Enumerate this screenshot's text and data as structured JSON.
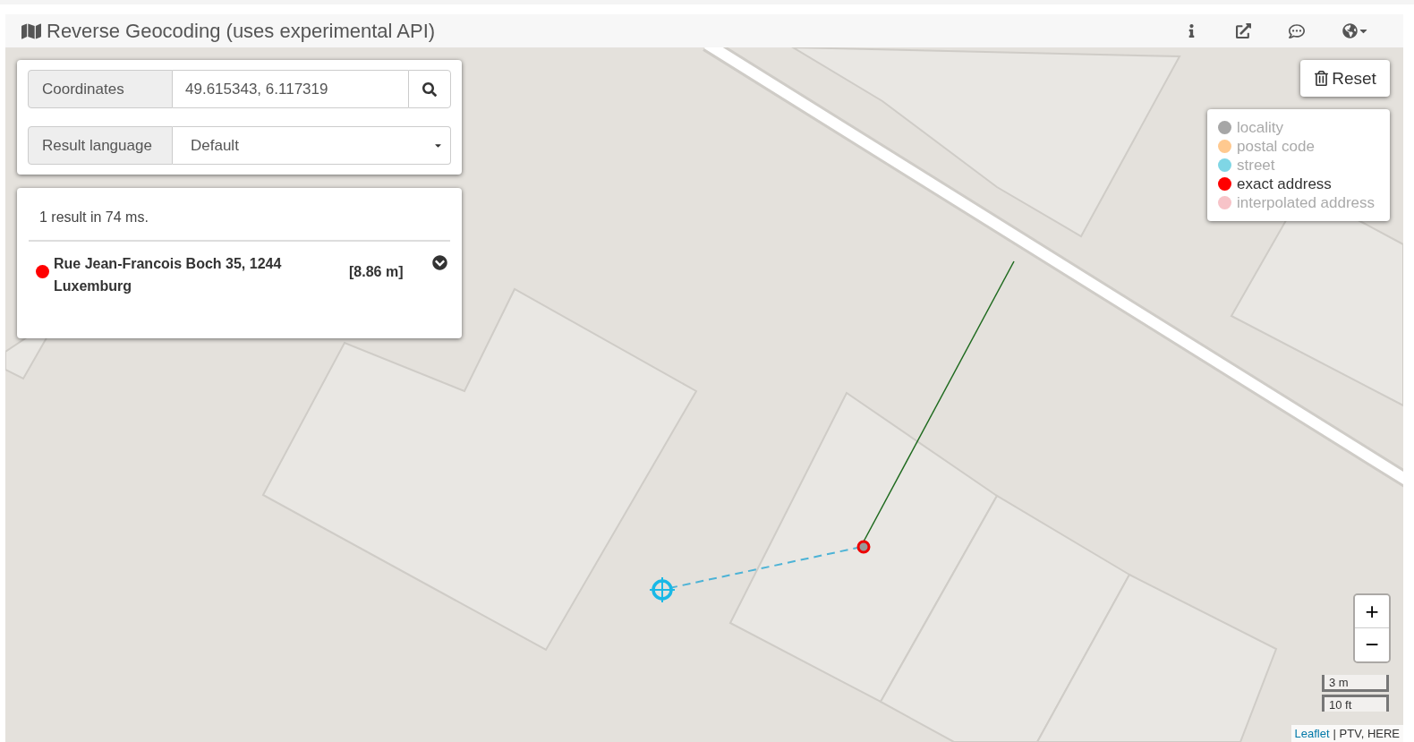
{
  "header": {
    "title": "Reverse Geocoding (uses experimental API)"
  },
  "search": {
    "coordinates_label": "Coordinates",
    "coordinates_value": "49.615343, 6.117319",
    "language_label": "Result language",
    "language_value": "Default"
  },
  "results": {
    "summary": "1 result in 74 ms.",
    "items": [
      {
        "address": "Rue Jean-Francois Boch 35, 1244 Luxemburg",
        "distance": "[8.86 m]",
        "color": "#ff0000",
        "expanded": false
      }
    ]
  },
  "reset": {
    "label": "Reset"
  },
  "legend": [
    {
      "label": "locality",
      "color": "#a6a6a6",
      "active": false
    },
    {
      "label": "postal code",
      "color": "#ffc98f",
      "active": false
    },
    {
      "label": "street",
      "color": "#7fd6e5",
      "active": false
    },
    {
      "label": "exact address",
      "color": "#ff0000",
      "active": true
    },
    {
      "label": "interpolated address",
      "color": "#f7c3c8",
      "active": false
    }
  ],
  "zoom": [
    "+",
    "−"
  ],
  "scale": [
    "3 m",
    "10 ft"
  ],
  "attribution": {
    "link": "Leaflet",
    "text": "| PTV, HERE"
  }
}
